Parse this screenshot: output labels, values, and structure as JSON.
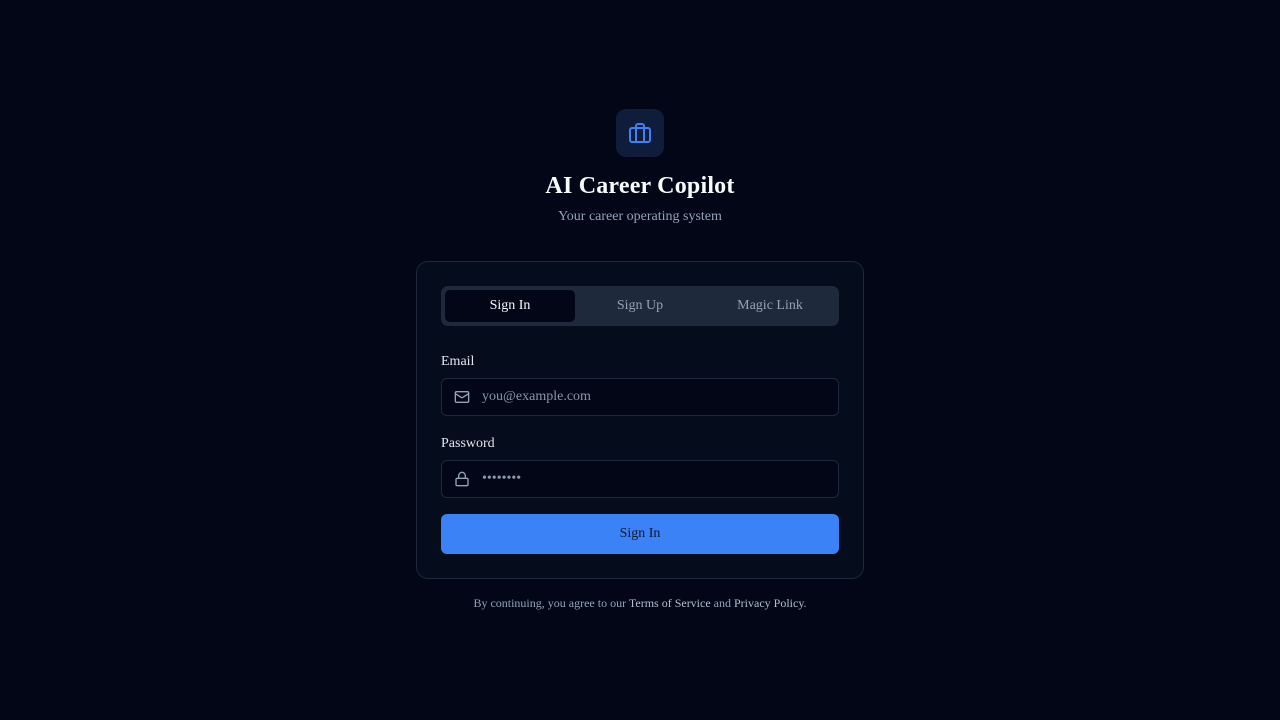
{
  "brand": {
    "icon": "briefcase-icon",
    "title": "AI Career Copilot",
    "subtitle": "Your career operating system",
    "accent": "#3b82f6"
  },
  "tabs": [
    {
      "label": "Sign In",
      "active": true
    },
    {
      "label": "Sign Up",
      "active": false
    },
    {
      "label": "Magic Link",
      "active": false
    }
  ],
  "form": {
    "email": {
      "label": "Email",
      "placeholder": "you@example.com",
      "icon": "mail-icon"
    },
    "password": {
      "label": "Password",
      "placeholder": "••••••••",
      "icon": "lock-icon"
    },
    "submit_label": "Sign In"
  },
  "footer": {
    "prefix": "By continuing, you agree to our",
    "terms": "Terms of Service",
    "and": "and",
    "privacy": "Privacy Policy",
    "suffix": "."
  }
}
